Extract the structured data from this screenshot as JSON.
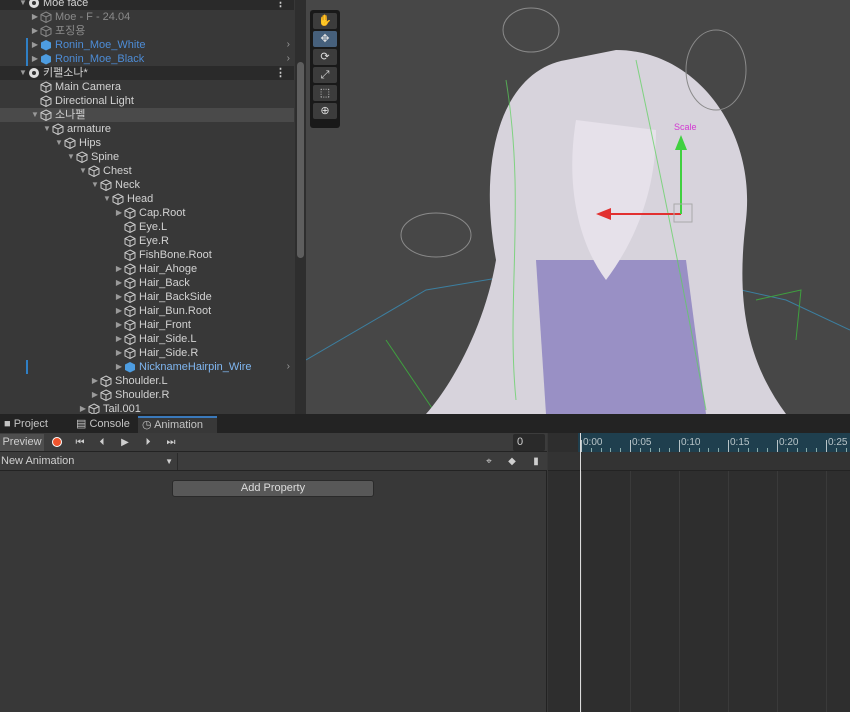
{
  "hierarchy": {
    "rows": [
      {
        "label": "Moe face",
        "type": "scene",
        "depth": 0,
        "expanded": true
      },
      {
        "label": "Moe - F - 24.04",
        "type": "grey",
        "depth": 1,
        "arrow": "right"
      },
      {
        "label": "포징용",
        "type": "grey",
        "depth": 1,
        "arrow": "right"
      },
      {
        "label": "Ronin_Moe_White",
        "type": "blue",
        "depth": 1,
        "arrow": "right",
        "prefab": true
      },
      {
        "label": "Ronin_Moe_Black",
        "type": "blue",
        "depth": 1,
        "arrow": "right",
        "prefab": true
      },
      {
        "label": "키펠소나*",
        "type": "scene",
        "depth": 0,
        "expanded": true
      },
      {
        "label": "Main Camera",
        "depth": 1
      },
      {
        "label": "Directional Light",
        "depth": 1
      },
      {
        "label": "소나펠",
        "depth": 1,
        "arrow": "down",
        "selected": true
      },
      {
        "label": "armature",
        "depth": 2,
        "arrow": "down"
      },
      {
        "label": "Hips",
        "depth": 3,
        "arrow": "down"
      },
      {
        "label": "Spine",
        "depth": 4,
        "arrow": "down"
      },
      {
        "label": "Chest",
        "depth": 5,
        "arrow": "down"
      },
      {
        "label": "Neck",
        "depth": 6,
        "arrow": "down"
      },
      {
        "label": "Head",
        "depth": 7,
        "arrow": "down"
      },
      {
        "label": "Cap.Root",
        "depth": 8,
        "arrow": "right"
      },
      {
        "label": "Eye.L",
        "depth": 8
      },
      {
        "label": "Eye.R",
        "depth": 8
      },
      {
        "label": "FishBone.Root",
        "depth": 8
      },
      {
        "label": "Hair_Ahoge",
        "depth": 8,
        "arrow": "right"
      },
      {
        "label": "Hair_Back",
        "depth": 8,
        "arrow": "right"
      },
      {
        "label": "Hair_BackSide",
        "depth": 8,
        "arrow": "right"
      },
      {
        "label": "Hair_Bun.Root",
        "depth": 8,
        "arrow": "right"
      },
      {
        "label": "Hair_Front",
        "depth": 8,
        "arrow": "right"
      },
      {
        "label": "Hair_Side.L",
        "depth": 8,
        "arrow": "right"
      },
      {
        "label": "Hair_Side.R",
        "depth": 8,
        "arrow": "right"
      },
      {
        "label": "NicknameHairpin_Wire",
        "type": "blue2",
        "depth": 8,
        "arrow": "right",
        "prefab": true
      },
      {
        "label": "Shoulder.L",
        "depth": 6,
        "arrow": "right"
      },
      {
        "label": "Shoulder.R",
        "depth": 6,
        "arrow": "right"
      },
      {
        "label": "Tail.001",
        "depth": 5,
        "arrow": "right"
      }
    ]
  },
  "scene": {
    "tools": [
      "hand-tool",
      "move-tool",
      "rotate-tool",
      "scale-tool",
      "rect-tool",
      "transform-tool"
    ],
    "active_tool": "move-tool",
    "gizmo_label": "Scale"
  },
  "tabs": [
    {
      "label": "Project",
      "icon": "folder-icon"
    },
    {
      "label": "Console",
      "icon": "console-icon"
    },
    {
      "label": "Animation",
      "icon": "clock-icon",
      "active": true
    }
  ],
  "animation": {
    "preview_label": "Preview",
    "frame_value": "0",
    "clip_name": "New Animation",
    "add_property_label": "Add Property",
    "ruler_labels": [
      "0:00",
      "0:05",
      "0:10",
      "0:15",
      "0:20",
      "0:25"
    ],
    "record_color": "#f0542d"
  }
}
